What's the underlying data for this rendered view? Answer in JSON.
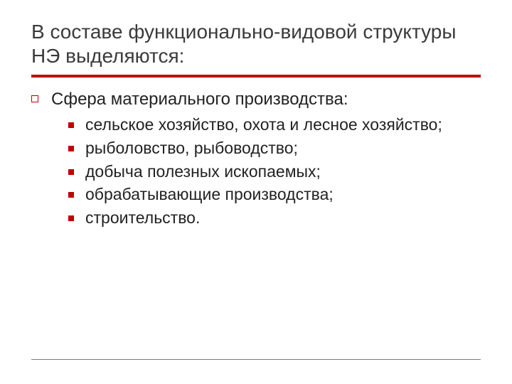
{
  "title": "В составе функционально-видовой структуры НЭ выделяются:",
  "lvl1_label": "Сфера материального производства:",
  "items": [
    "сельское хозяйство, охота и лесное хозяйство;",
    "рыболовство, рыбоводство;",
    "добыча полезных ископаемых;",
    "обрабатывающие производства;",
    "строительство."
  ]
}
